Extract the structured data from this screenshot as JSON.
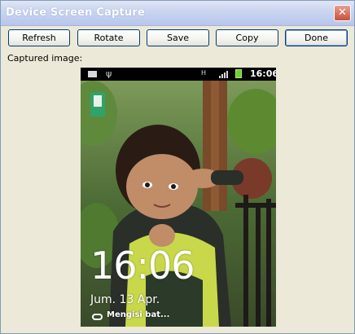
{
  "window": {
    "title": "Device Screen Capture",
    "close_glyph": "✕"
  },
  "toolbar": {
    "refresh_label": "Refresh",
    "rotate_label": "Rotate",
    "save_label": "Save",
    "copy_label": "Copy",
    "done_label": "Done"
  },
  "capture": {
    "label": "Captured image:"
  },
  "device": {
    "status_bar": {
      "time": "16:06",
      "network_type": "H",
      "icons": [
        "mail-icon",
        "usb-icon",
        "hspa-icon",
        "signal-icon",
        "battery-charging-icon"
      ]
    },
    "lockscreen": {
      "clock": "16:06",
      "date": "Jum. 13 Apr.",
      "charging_text": "Mengisi bat..."
    }
  },
  "colors": {
    "window_bg": "#ece9d8",
    "titlebar_start": "#e1e6f6",
    "titlebar_end": "#b8c6ec",
    "close_button": "#c9503a",
    "button_border": "#003c74"
  }
}
